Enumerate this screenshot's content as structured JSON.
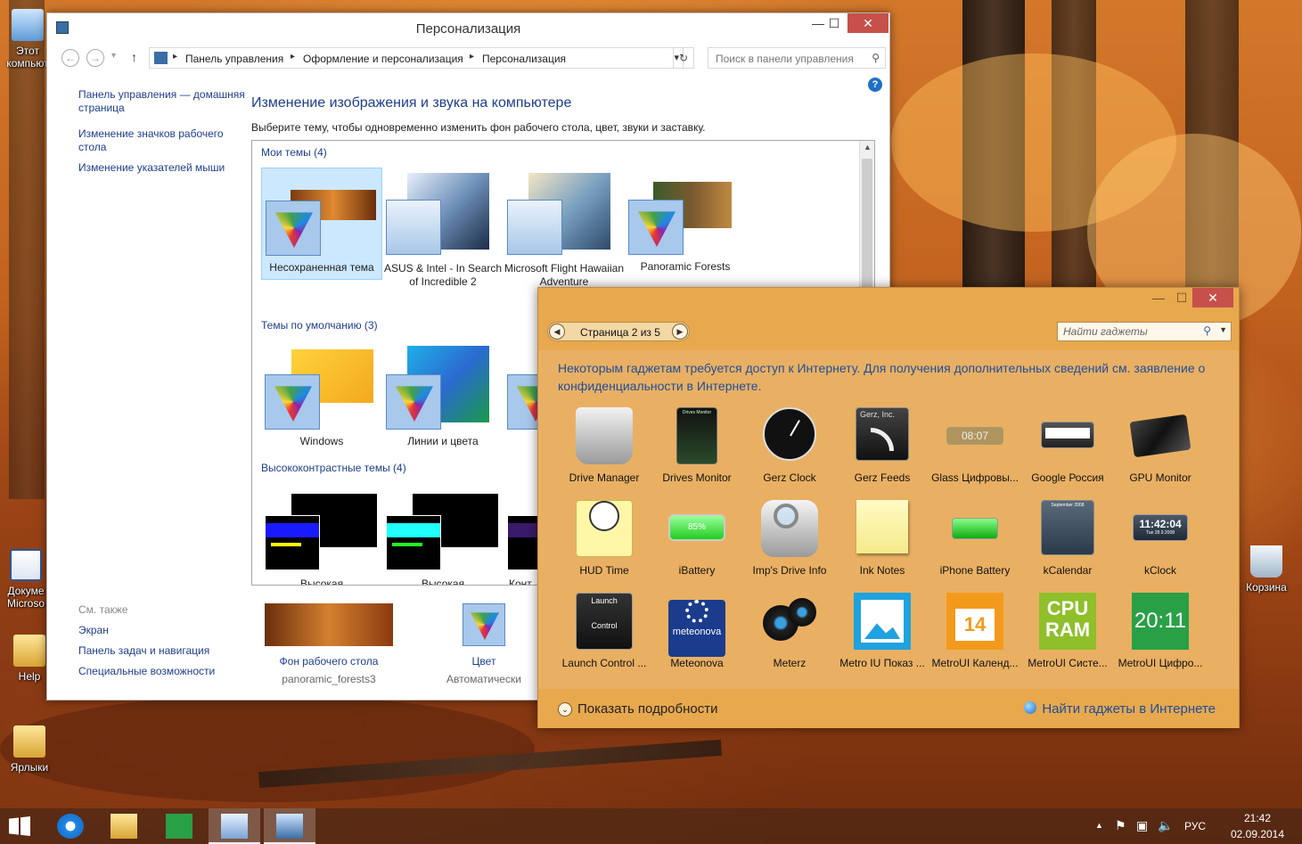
{
  "desktop": {
    "icons": [
      {
        "label": "Этот компьют"
      },
      {
        "label": "Докуме Microso"
      },
      {
        "label": "Help"
      },
      {
        "label": "Ярлыки"
      },
      {
        "label": "Корзина"
      }
    ]
  },
  "explorer": {
    "title": "Персонализация",
    "window_buttons": {
      "minimize": "—",
      "maximize": "☐",
      "close": "✕"
    },
    "nav": {
      "back": "←",
      "forward": "→",
      "dropdown": "▾",
      "up": "↑"
    },
    "breadcrumb": [
      "Панель управления",
      "Оформление и персонализация",
      "Персонализация"
    ],
    "breadcrumb_sep": "▸",
    "address_dropdown": "▾",
    "refresh": "↻",
    "search_placeholder": "Поиск в панели управления",
    "left_links": [
      "Панель управления — домашняя страница",
      "Изменение значков рабочего стола",
      "Изменение указателей мыши"
    ],
    "see_also_heading": "См. также",
    "see_also_links": [
      "Экран",
      "Панель задач и навигация",
      "Специальные возможности"
    ],
    "help": "?",
    "heading": "Изменение изображения и звука на компьютере",
    "subheading": "Выберите тему, чтобы одновременно изменить фон рабочего стола, цвет, звуки и заставку.",
    "sections": [
      {
        "title": "Мои темы (4)",
        "themes": [
          "Несохраненная тема",
          "ASUS & Intel - In Search of Incredible 2",
          "Microsoft Flight Hawaiian Adventure",
          "Panoramic Forests"
        ]
      },
      {
        "title": "Темы по умолчанию (3)",
        "themes": [
          "Windows",
          "Линии и цвета",
          ""
        ]
      },
      {
        "title": "Высококонтрастные темы (4)",
        "themes": [
          "Высокая",
          "Высокая",
          "Конт"
        ]
      }
    ],
    "bottom": [
      {
        "label": "Фон рабочего стола",
        "sub": "panoramic_forests3"
      },
      {
        "label": "Цвет",
        "sub": "Автоматически"
      }
    ]
  },
  "gadgets": {
    "window_buttons": {
      "minimize": "—",
      "maximize": "☐",
      "close": "✕"
    },
    "pager_prev": "◀",
    "pager_next": "▶",
    "page_label": "Страница 2 из 5",
    "search_placeholder": "Найти гаджеты",
    "search_icon": "⚲",
    "search_dropdown": "▼",
    "info": "Некоторым гаджетам требуется доступ к Интернету. Для получения дополнительных сведений см. заявление о конфиденциальности в Интернете.",
    "items": [
      "Drive Manager",
      "Drives Monitor",
      "Gerz Clock",
      "Gerz Feeds",
      "Glass Цифровы...",
      "Google Россия",
      "GPU Monitor",
      "HUD Time",
      "iBattery",
      "Imp's Drive Info",
      "Ink Notes",
      "iPhone Battery",
      "kCalendar",
      "kClock",
      "Launch Control ...",
      "Meteonova",
      "Meterz",
      "Metro IU Показ ...",
      "MetroUI Календ...",
      "MetroUI Систе...",
      "MetroUI Цифро..."
    ],
    "icon_texts": {
      "gerz_feeds": "Gerz, Inc.",
      "glass_time": "08:07",
      "ibattery": "85%",
      "kclock_time": "11:42:04",
      "kclock_date": "Tue 28.9.2008",
      "launch_top": "Launch",
      "launch_bottom": "Control",
      "meteonova": "meteonova",
      "metro_cal": "14",
      "cpu": "CPU",
      "ram": "RAM",
      "metro_clock": "20:11",
      "drives_monitor": "Drives Monitor",
      "kcalendar": "September 2008"
    },
    "show_details": "Показать подробности",
    "show_details_icon": "⌄",
    "find_online": "Найти гаджеты в Интернете"
  },
  "taskbar": {
    "tray_lang": "РУС",
    "time": "21:42",
    "date": "02.09.2014",
    "tray_arrow": "▲",
    "tray_icons": [
      "⚑",
      "▣",
      "🔈"
    ]
  }
}
